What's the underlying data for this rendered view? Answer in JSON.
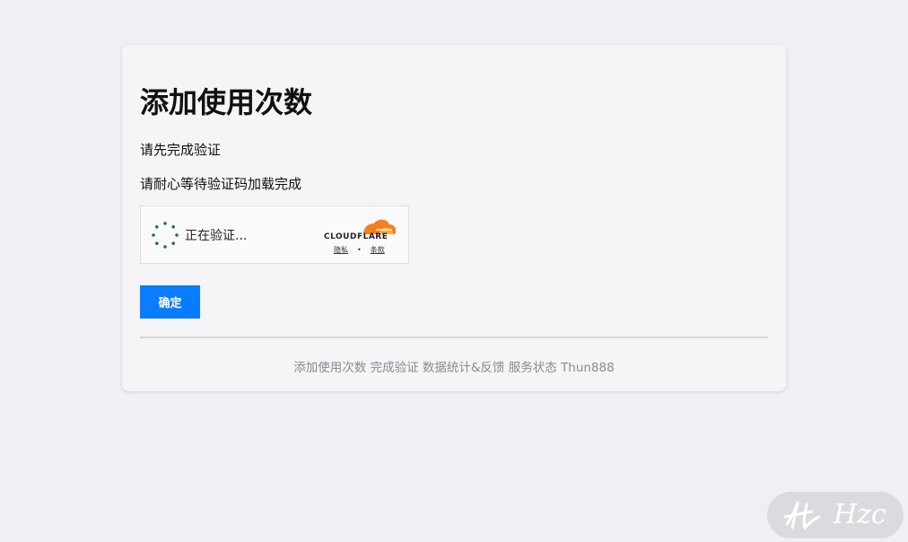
{
  "page": {
    "title": "添加使用次数",
    "instruction_1": "请先完成验证",
    "instruction_2": "请耐心等待验证码加载完成"
  },
  "captcha": {
    "status_text": "正在验证...",
    "provider": "CLOUDFLARE",
    "privacy_link": "隐私",
    "terms_link": "条款",
    "separator": "•",
    "accent_color": "#f38020",
    "spinner_color": "#1a7a46"
  },
  "actions": {
    "confirm_label": "确定",
    "confirm_color": "#0a7cff"
  },
  "footer": {
    "links": [
      {
        "label": "添加使用次数"
      },
      {
        "label": "完成验证"
      },
      {
        "label": "数据统计&反馈"
      },
      {
        "label": "服务状态"
      },
      {
        "label": "Thun888"
      }
    ]
  },
  "watermark": {
    "text": "Hzc"
  }
}
